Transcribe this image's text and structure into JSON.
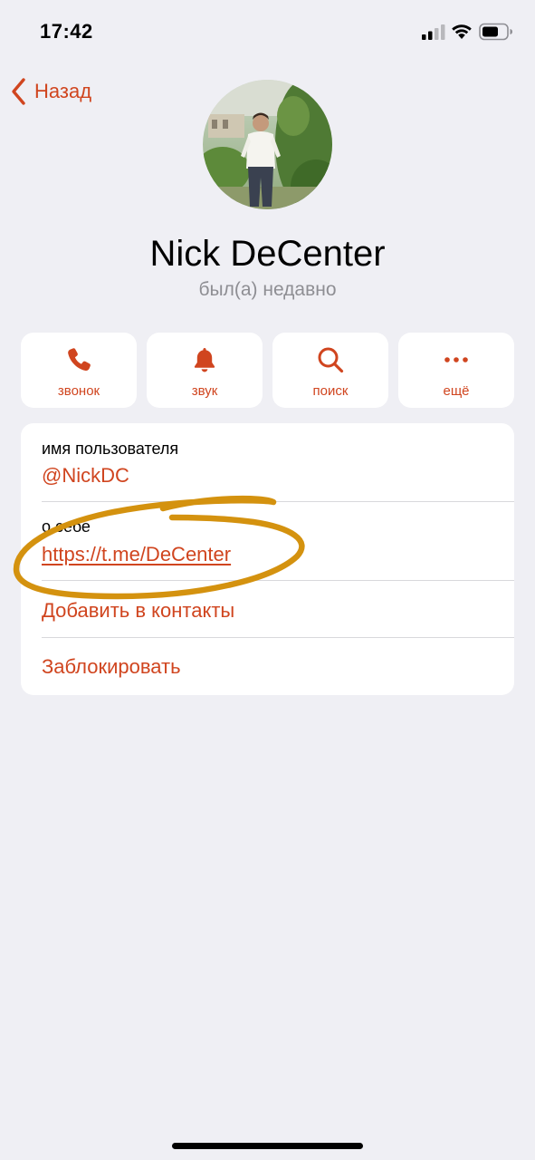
{
  "status_bar": {
    "time": "17:42",
    "icons": [
      "signal-icon",
      "wifi-icon",
      "battery-icon"
    ]
  },
  "nav": {
    "back_label": "Назад"
  },
  "profile": {
    "name": "Nick DeCenter",
    "status": "был(а) недавно"
  },
  "actions": [
    {
      "label": "звонок",
      "icon": "phone-icon"
    },
    {
      "label": "звук",
      "icon": "bell-icon"
    },
    {
      "label": "поиск",
      "icon": "search-icon"
    },
    {
      "label": "ещё",
      "icon": "more-icon"
    }
  ],
  "info": {
    "username_caption": "имя пользователя",
    "username_value": "@NickDC",
    "bio_caption": "о себе",
    "bio_link": "https://t.me/DeCenter",
    "add_contact": "Добавить в контакты",
    "block": "Заблокировать"
  },
  "colors": {
    "accent": "#d0451f",
    "background": "#efeff4",
    "annotation": "#d4920f"
  }
}
